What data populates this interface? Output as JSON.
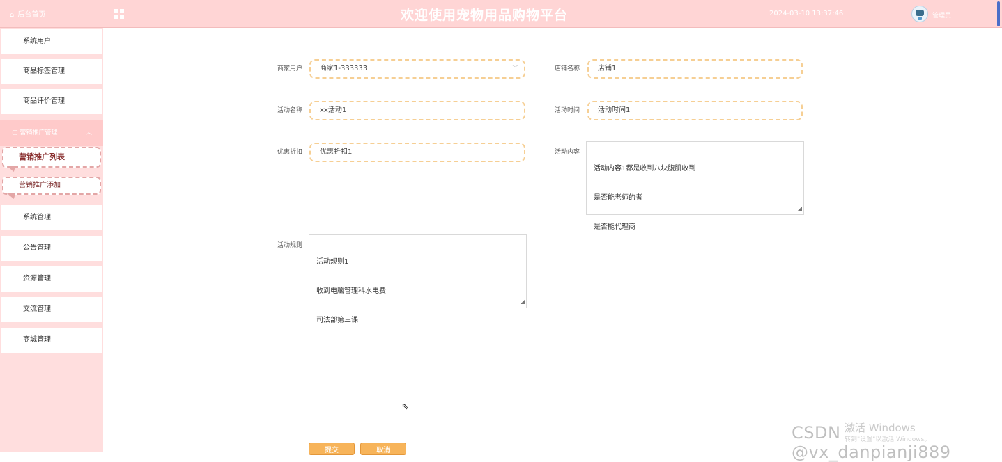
{
  "header": {
    "home_label": "后台首页",
    "title": "欢迎使用宠物用品购物平台",
    "datetime": "2024-03-10 13:37:46",
    "user_label": "管理员"
  },
  "sidebar": {
    "items_top": [
      "系统用户",
      "商品标签管理",
      "商品评价管理"
    ],
    "group_label": "营销推广管理",
    "sub_items": [
      "营销推广列表",
      "营销推广添加"
    ],
    "items_bottom": [
      "系统管理",
      "公告管理",
      "资源管理",
      "交流管理",
      "商城管理"
    ]
  },
  "form": {
    "merchant_label": "商家用户",
    "merchant_value": "商家1-333333",
    "shop_label": "店铺名称",
    "shop_value": "店铺1",
    "activity_name_label": "活动名称",
    "activity_name_value": "xx活动1",
    "activity_time_label": "活动时间",
    "activity_time_value": "活动时间1",
    "discount_label": "优惠折扣",
    "discount_value": "优惠折扣1",
    "content_label": "活动内容",
    "content_lines": [
      "活动内容1都是收到八块腹肌收到",
      "是否能老师的者",
      "是否能代理商"
    ],
    "rules_label": "活动规则",
    "rules_lines": [
      "活动规则1",
      "收到电脑管理科水电费",
      "司法部第三课"
    ],
    "submit_label": "提交",
    "cancel_label": "取消"
  },
  "watermarks": {
    "activate_line1": "激活 Windows",
    "activate_line2": "转到\"设置\"以激活 Windows。",
    "csdn": "CSDN @vx_danpianji889"
  },
  "colors": {
    "header_bg": "#ffd5d5",
    "sidebar_bg": "#ffdede",
    "accent_button": "#f7b45a",
    "field_border": "#f6cf94"
  }
}
